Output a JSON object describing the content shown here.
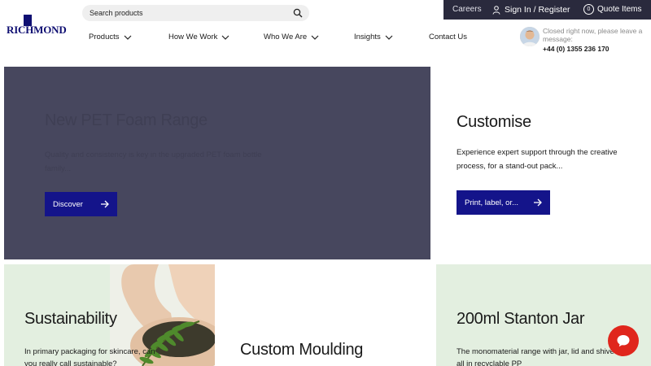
{
  "brand": {
    "name": "RICHMOND"
  },
  "search": {
    "placeholder": "Search products"
  },
  "topbar": {
    "careers": "Careers",
    "signin": "Sign In / Register",
    "quote_count": "0",
    "quote_label": "Quote Items"
  },
  "nav": {
    "items": [
      {
        "label": "Products"
      },
      {
        "label": "How We Work"
      },
      {
        "label": "Who We Are"
      },
      {
        "label": "Insights"
      },
      {
        "label": "Contact Us"
      }
    ]
  },
  "contact": {
    "message": "Closed right now, please leave a message:",
    "phone": "+44 (0) 1355 236 170"
  },
  "hero": {
    "title": "New PET Foam Range",
    "text": "Quality and consistency is key in the upgraded PET foam bottle family...",
    "button": "Discover"
  },
  "customise": {
    "title": "Customise",
    "text": "Experience expert support through the creative process, for a stand-out pack...",
    "button": "Print, label, or..."
  },
  "sustainability": {
    "title": "Sustainability",
    "text": "In primary packaging for skincare, can you really call sustainable?"
  },
  "moulding": {
    "title": "Custom Moulding"
  },
  "jar": {
    "title": "200ml Stanton Jar",
    "text": "The monomaterial range with jar, lid and shive all in recyclable PP"
  },
  "colors": {
    "brand_navy": "#0f0f72",
    "button": "#14148a",
    "hero_bg": "#47475e",
    "topbar_bg": "#2a2a3d",
    "tile_green": "#e3efe0",
    "chat_red": "#e0261c"
  },
  "icons": {
    "search": "search-icon",
    "user": "user-icon",
    "chevron": "chevron-down-icon",
    "arrow": "arrow-right-icon",
    "chat": "chat-icon"
  }
}
